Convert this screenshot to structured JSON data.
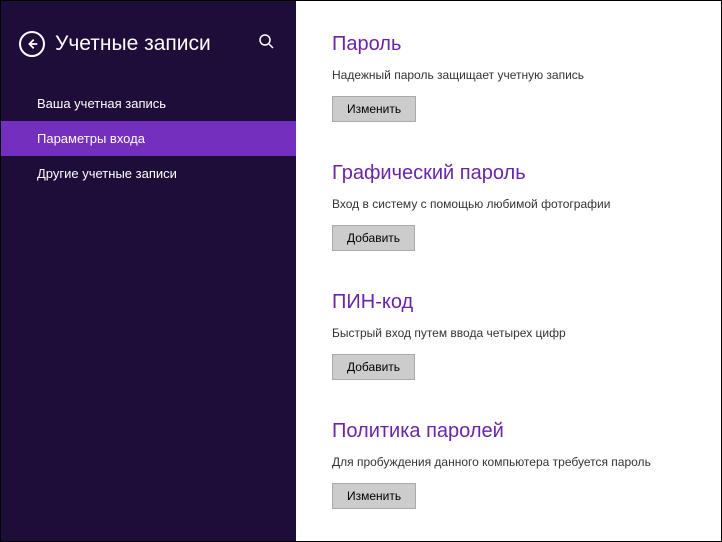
{
  "sidebar": {
    "title": "Учетные записи",
    "items": [
      {
        "label": "Ваша учетная запись",
        "selected": false
      },
      {
        "label": "Параметры входа",
        "selected": true
      },
      {
        "label": "Другие учетные записи",
        "selected": false
      }
    ]
  },
  "sections": [
    {
      "title": "Пароль",
      "desc": "Надежный пароль защищает учетную запись",
      "button": "Изменить"
    },
    {
      "title": "Графический пароль",
      "desc": "Вход в систему с помощью любимой фотографии",
      "button": "Добавить"
    },
    {
      "title": "ПИН-код",
      "desc": "Быстрый вход путем ввода четырех цифр",
      "button": "Добавить"
    },
    {
      "title": "Политика паролей",
      "desc": "Для пробуждения данного компьютера требуется пароль",
      "button": "Изменить"
    }
  ]
}
